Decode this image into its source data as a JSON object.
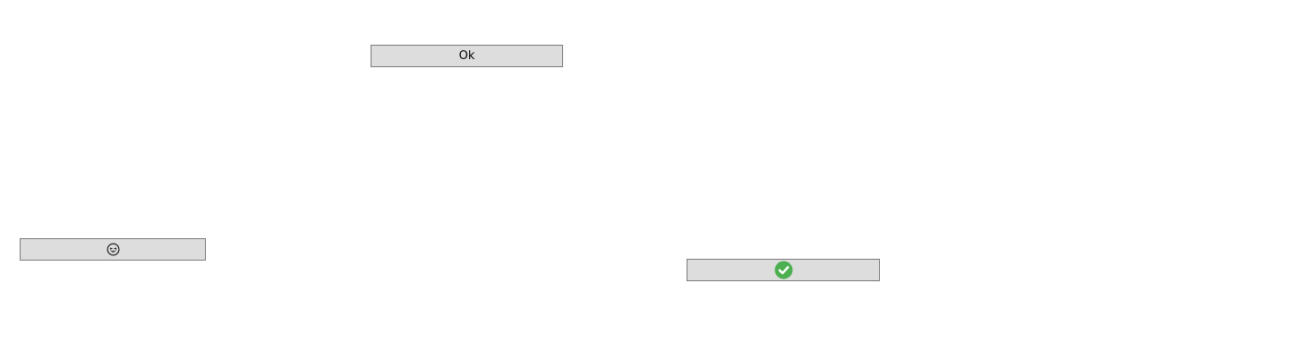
{
  "buttons": {
    "ok": {
      "label": "Ok"
    },
    "emoji": {
      "icon": "grinning-squinting-face-icon"
    },
    "confirm": {
      "icon": "green-checkmark-circle-icon",
      "icon_color": "#4caf50"
    }
  },
  "colors": {
    "button_bg": "#dddddd",
    "button_border": "#7a7a7a",
    "page_bg": "#ffffff"
  }
}
